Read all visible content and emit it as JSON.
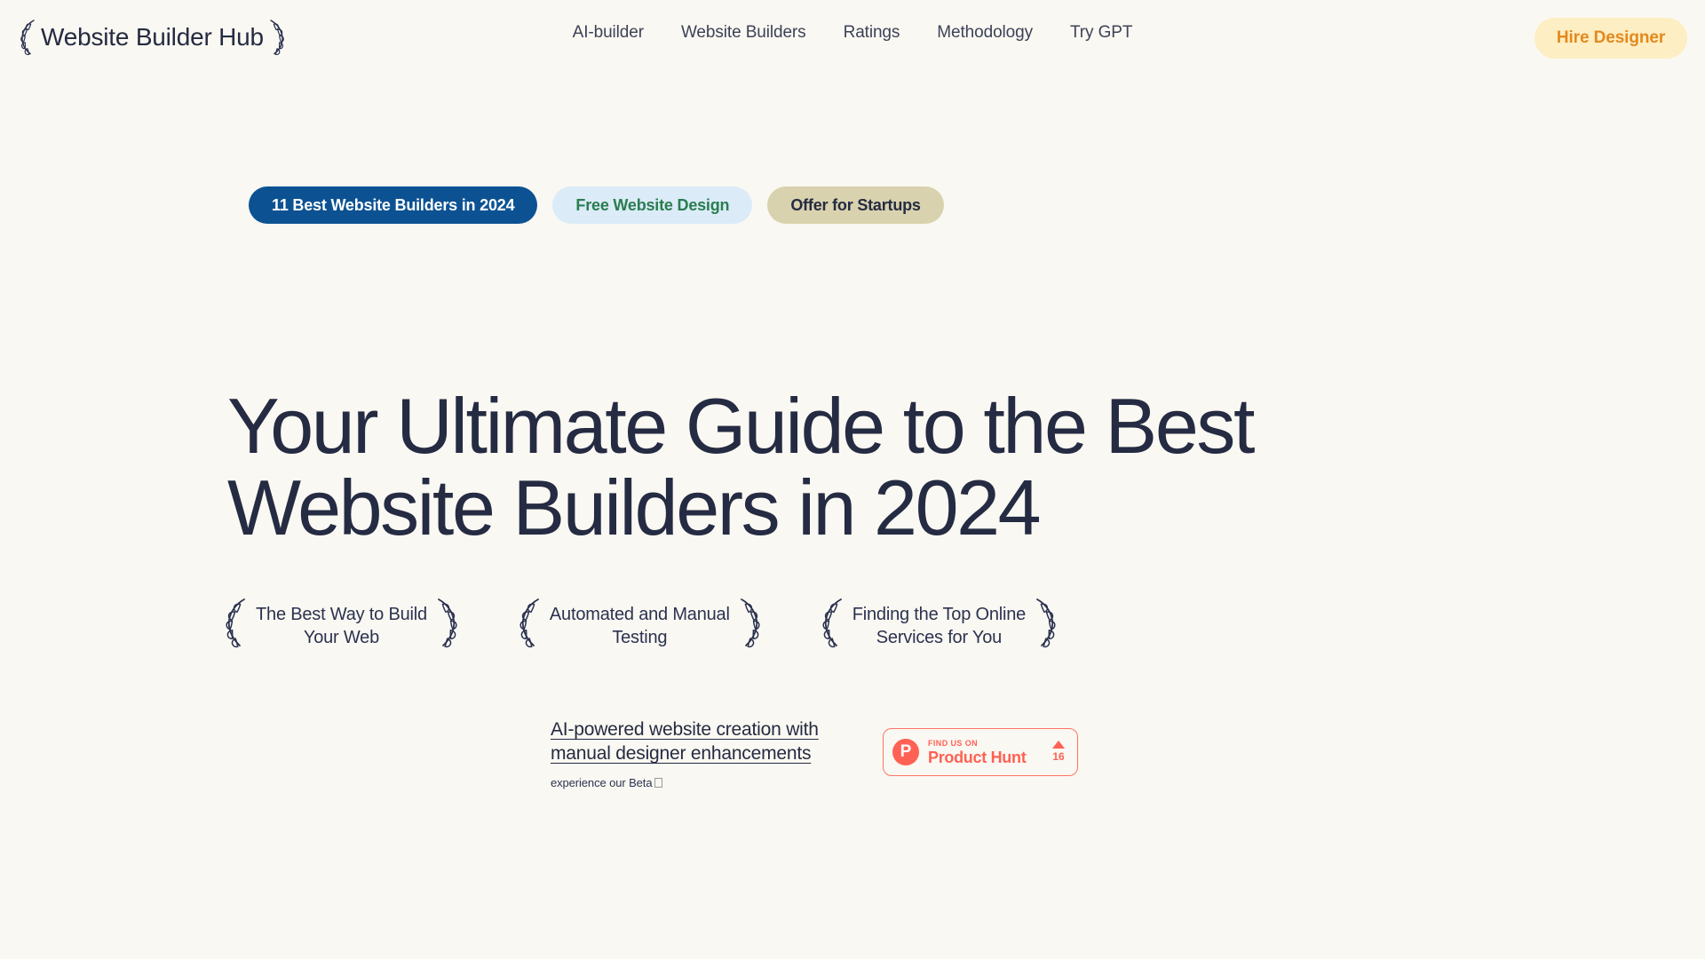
{
  "colors": {
    "page_background": "#faf8f2",
    "ink": "#252b42",
    "pill_primary_bg": "#0c5293",
    "pill_primary_text": "#ffffff",
    "pill_secondary_bg": "#dbebf8",
    "pill_secondary_text": "#2a7d4f",
    "pill_tertiary_bg": "#d8d2ae",
    "pill_tertiary_text": "#252b42",
    "cta_bg": "#fdeec3",
    "cta_text": "#e3891d",
    "product_hunt": "#ff6154"
  },
  "header": {
    "brand": {
      "name": "Website Builder Hub",
      "left_icon": "laurel-branch-icon",
      "right_icon": "laurel-branch-icon"
    },
    "nav": [
      {
        "label": "AI-builder"
      },
      {
        "label": "Website Builders"
      },
      {
        "label": "Ratings"
      },
      {
        "label": "Methodology"
      },
      {
        "label": "Try GPT"
      }
    ],
    "cta": {
      "label": "Hire Designer"
    }
  },
  "hero": {
    "pills": [
      {
        "label": "11 Best Website Builders in 2024",
        "style": "primary"
      },
      {
        "label": "Free Website Design",
        "style": "secondary"
      },
      {
        "label": "Offer for Startups",
        "style": "tertiary"
      }
    ],
    "title": "Your Ultimate Guide to the Best Website Builders in 2024",
    "badges": [
      {
        "text": "The Best Way to Build\nYour Web"
      },
      {
        "text": "Automated and Manual\nTesting"
      },
      {
        "text": "Finding the Top Online\nServices for You"
      }
    ],
    "beta": {
      "link_text": "AI-powered website creation with manual designer enhancements",
      "sub_text": "experience our Beta"
    },
    "product_hunt": {
      "kicker": "FIND US ON",
      "name": "Product Hunt",
      "vote_count": "16",
      "logo_letter": "P"
    }
  }
}
